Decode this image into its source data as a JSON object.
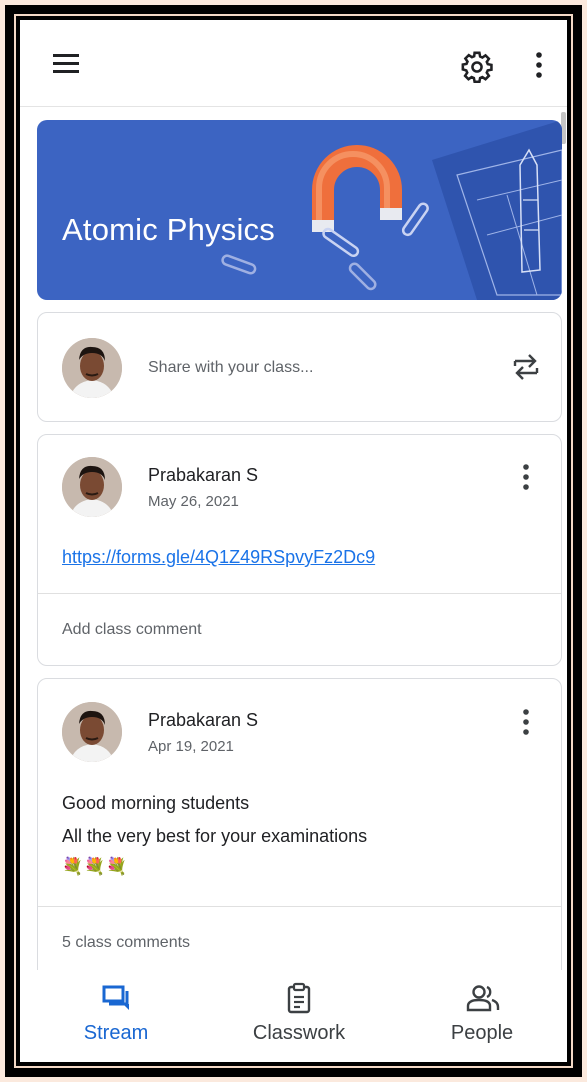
{
  "toolbar": {
    "menu_icon": "hamburger-icon",
    "settings_icon": "gear-icon",
    "more_icon": "vertical-dots-icon"
  },
  "banner": {
    "title": "Atomic Physics",
    "bg_color": "#3c64c2"
  },
  "share": {
    "placeholder": "Share with your class...",
    "repost_icon": "swap-arrows-icon"
  },
  "posts": [
    {
      "author": "Prabakaran S",
      "date": "May 26, 2021",
      "link": "https://forms.gle/4Q1Z49RSpvyFz2Dc9",
      "comment_action": "Add class comment"
    },
    {
      "author": "Prabakaran S",
      "date": "Apr 19, 2021",
      "line1": "Good morning students",
      "line2": "All the very best for your examinations",
      "emoji": "💐💐💐",
      "comment_action": "5 class comments"
    }
  ],
  "nav": {
    "items": [
      {
        "label": "Stream",
        "icon": "stream-icon",
        "active": true,
        "color": "#1967d2"
      },
      {
        "label": "Classwork",
        "icon": "clipboard-icon",
        "active": false,
        "color": "#3c4043"
      },
      {
        "label": "People",
        "icon": "people-icon",
        "active": false,
        "color": "#3c4043"
      }
    ]
  }
}
